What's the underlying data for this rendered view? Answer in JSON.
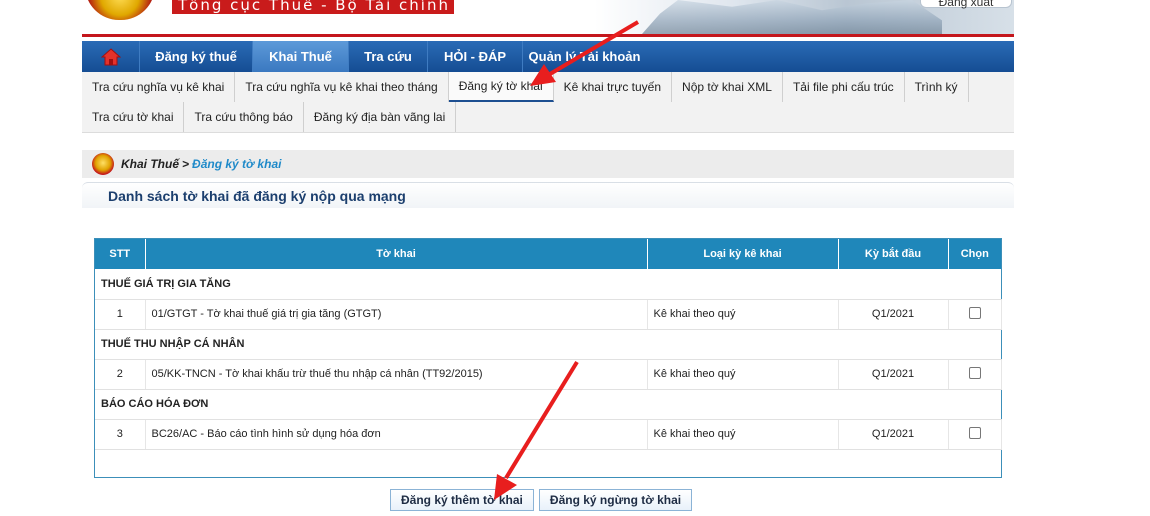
{
  "banner": {
    "agency": "Tổng cục Thuế - Bộ Tài chính",
    "logout": "Đăng xuất"
  },
  "mainnav": [
    {
      "label": "Đăng ký thuế"
    },
    {
      "label": "Khai Thuế"
    },
    {
      "label": "Tra cứu"
    },
    {
      "label": "HỎI - ĐÁP"
    },
    {
      "label": "Quản lý Tài khoản"
    }
  ],
  "subnav": {
    "row1": [
      "Tra cứu nghĩa vụ kê khai",
      "Tra cứu nghĩa vụ kê khai theo tháng",
      "Đăng ký tờ khai",
      "Kê khai trực tuyến",
      "Nộp tờ khai XML",
      "Tải file phi cấu trúc",
      "Trình ký"
    ],
    "row2": [
      "Tra cứu tờ khai",
      "Tra cứu thông báo",
      "Đăng ký địa bàn vãng lai"
    ]
  },
  "breadcrumb": {
    "parent": "Khai Thuế",
    "sep": ">",
    "current": "Đăng ký tờ khai"
  },
  "section_title": "Danh sách tờ khai đã đăng ký nộp qua mạng",
  "table": {
    "headers": [
      "STT",
      "Tờ khai",
      "Loại kỳ kê khai",
      "Kỳ bắt đầu",
      "Chọn"
    ],
    "groups": [
      {
        "name": "THUẾ GIÁ TRỊ GIA TĂNG",
        "stt": "1",
        "form": "01/GTGT - Tờ khai thuế giá trị gia tăng (GTGT)",
        "period_type": "Kê khai theo quý",
        "start": "Q1/2021"
      },
      {
        "name": "THUẾ THU NHẬP CÁ NHÂN",
        "stt": "2",
        "form": "05/KK-TNCN - Tờ khai khấu trừ thuế thu nhập cá nhân (TT92/2015)",
        "period_type": "Kê khai theo quý",
        "start": "Q1/2021"
      },
      {
        "name": "BÁO CÁO HÓA ĐƠN",
        "stt": "3",
        "form": "BC26/AC - Báo cáo tình hình sử dụng hóa đơn",
        "period_type": "Kê khai theo quý",
        "start": "Q1/2021"
      }
    ]
  },
  "buttons": {
    "register_more": "Đăng ký thêm tờ khai",
    "stop_register": "Đăng ký ngừng tờ khai"
  },
  "colors": {
    "nav_blue": "#154d93",
    "header_blue": "#1f87ba",
    "annotation_red": "#e81e1e",
    "brand_red": "#c4161c"
  },
  "icons": {
    "home": "home-icon"
  }
}
